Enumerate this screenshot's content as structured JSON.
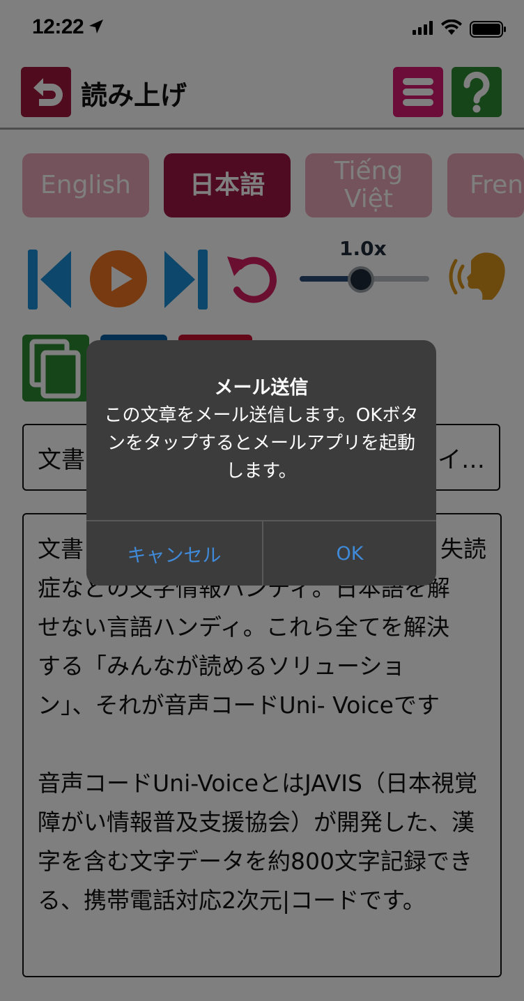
{
  "status_bar": {
    "time": "12:22"
  },
  "header": {
    "title": "読み上げ",
    "back_icon": "back-arrow-icon",
    "menu_icon": "hamburger-icon",
    "help_icon": "question-icon",
    "colors": {
      "back": "#a3163e",
      "menu": "#d81b73",
      "help": "#2e8b35"
    }
  },
  "language_tabs": [
    {
      "label": "English",
      "active": false
    },
    {
      "label": "日本語",
      "active": true
    },
    {
      "label": "Tiếng Việt",
      "active": false
    },
    {
      "label": "Fren",
      "active": false
    }
  ],
  "playback": {
    "speed_label": "1.0x",
    "speed_level": 0.48,
    "icons": [
      "skip-back-icon",
      "play-icon",
      "skip-forward-icon",
      "rewind-icon",
      "speaker-voice-icon"
    ]
  },
  "actions": {
    "icons": [
      "copy-icon",
      "mail-icon",
      "share-icon"
    ],
    "colors": [
      "#2e8b35",
      "#0a5fa3",
      "#c8102e"
    ]
  },
  "document": {
    "title_visible": "文書",
    "title_visible_right": "イ…",
    "body_line1_left": "文書",
    "body_line1_right": "失読",
    "body_line2": "症などの文字情報ハンディ。日本語を解",
    "body_line3": "せない言語ハンディ。これら全てを解決",
    "body_line4": "する「みんなが読めるソリューショ",
    "body_line5": "ン」、それが音声コードUni- Voiceです",
    "body_para2": "音声コードUni-VoiceとはJAVIS（日本視覚障がい情報普及支援協会）が開発した、漢字を含む文字データを約800文字記録できる、携帯電話対応2次元|コードです。"
  },
  "alert": {
    "title": "メール送信",
    "message": "この文章をメール送信します。OKボタンをタップするとメールアプリを起動します。",
    "cancel_label": "キャンセル",
    "ok_label": "OK"
  }
}
